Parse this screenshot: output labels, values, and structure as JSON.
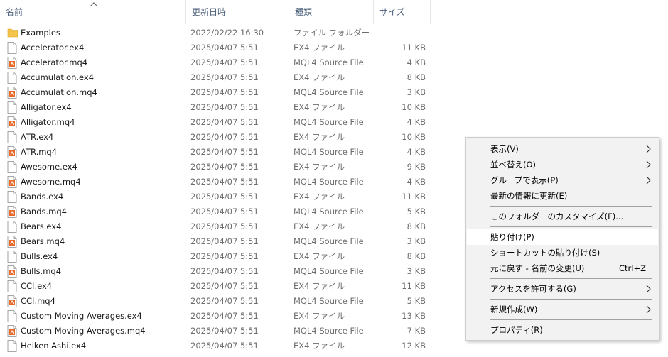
{
  "columns": {
    "name": "名前",
    "date": "更新日時",
    "type": "種類",
    "size": "サイズ"
  },
  "files": [
    {
      "name": "Examples",
      "date": "2022/02/22 16:30",
      "type": "ファイル フォルダー",
      "size": "",
      "icon": "folder-icon"
    },
    {
      "name": "Accelerator.ex4",
      "date": "2025/04/07 5:51",
      "type": "EX4 ファイル",
      "size": "11 KB",
      "icon": "file-icon"
    },
    {
      "name": "Accelerator.mq4",
      "date": "2025/04/07 5:51",
      "type": "MQL4 Source File",
      "size": "4 KB",
      "icon": "mq4-file-icon"
    },
    {
      "name": "Accumulation.ex4",
      "date": "2025/04/07 5:51",
      "type": "EX4 ファイル",
      "size": "8 KB",
      "icon": "file-icon"
    },
    {
      "name": "Accumulation.mq4",
      "date": "2025/04/07 5:51",
      "type": "MQL4 Source File",
      "size": "3 KB",
      "icon": "mq4-file-icon"
    },
    {
      "name": "Alligator.ex4",
      "date": "2025/04/07 5:51",
      "type": "EX4 ファイル",
      "size": "10 KB",
      "icon": "file-icon"
    },
    {
      "name": "Alligator.mq4",
      "date": "2025/04/07 5:51",
      "type": "MQL4 Source File",
      "size": "4 KB",
      "icon": "mq4-file-icon"
    },
    {
      "name": "ATR.ex4",
      "date": "2025/04/07 5:51",
      "type": "EX4 ファイル",
      "size": "10 KB",
      "icon": "file-icon"
    },
    {
      "name": "ATR.mq4",
      "date": "2025/04/07 5:51",
      "type": "MQL4 Source File",
      "size": "4 KB",
      "icon": "mq4-file-icon"
    },
    {
      "name": "Awesome.ex4",
      "date": "2025/04/07 5:51",
      "type": "EX4 ファイル",
      "size": "9 KB",
      "icon": "file-icon"
    },
    {
      "name": "Awesome.mq4",
      "date": "2025/04/07 5:51",
      "type": "MQL4 Source File",
      "size": "4 KB",
      "icon": "mq4-file-icon"
    },
    {
      "name": "Bands.ex4",
      "date": "2025/04/07 5:51",
      "type": "EX4 ファイル",
      "size": "11 KB",
      "icon": "file-icon"
    },
    {
      "name": "Bands.mq4",
      "date": "2025/04/07 5:51",
      "type": "MQL4 Source File",
      "size": "5 KB",
      "icon": "mq4-file-icon"
    },
    {
      "name": "Bears.ex4",
      "date": "2025/04/07 5:51",
      "type": "EX4 ファイル",
      "size": "8 KB",
      "icon": "file-icon"
    },
    {
      "name": "Bears.mq4",
      "date": "2025/04/07 5:51",
      "type": "MQL4 Source File",
      "size": "3 KB",
      "icon": "mq4-file-icon"
    },
    {
      "name": "Bulls.ex4",
      "date": "2025/04/07 5:51",
      "type": "EX4 ファイル",
      "size": "8 KB",
      "icon": "file-icon"
    },
    {
      "name": "Bulls.mq4",
      "date": "2025/04/07 5:51",
      "type": "MQL4 Source File",
      "size": "3 KB",
      "icon": "mq4-file-icon"
    },
    {
      "name": "CCI.ex4",
      "date": "2025/04/07 5:51",
      "type": "EX4 ファイル",
      "size": "11 KB",
      "icon": "file-icon"
    },
    {
      "name": "CCI.mq4",
      "date": "2025/04/07 5:51",
      "type": "MQL4 Source File",
      "size": "5 KB",
      "icon": "mq4-file-icon"
    },
    {
      "name": "Custom Moving Averages.ex4",
      "date": "2025/04/07 5:51",
      "type": "EX4 ファイル",
      "size": "13 KB",
      "icon": "file-icon"
    },
    {
      "name": "Custom Moving Averages.mq4",
      "date": "2025/04/07 5:51",
      "type": "MQL4 Source File",
      "size": "7 KB",
      "icon": "mq4-file-icon"
    },
    {
      "name": "Heiken Ashi.ex4",
      "date": "2025/04/07 5:51",
      "type": "EX4 ファイル",
      "size": "12 KB",
      "icon": "file-icon"
    }
  ],
  "context_menu": {
    "items": [
      {
        "label": "表示(V)",
        "submenu": true,
        "name": "menu-item-view"
      },
      {
        "label": "並べ替え(O)",
        "submenu": true,
        "name": "menu-item-sort"
      },
      {
        "label": "グループで表示(P)",
        "submenu": true,
        "name": "menu-item-group"
      },
      {
        "label": "最新の情報に更新(E)",
        "name": "menu-item-refresh"
      },
      {
        "separator": true
      },
      {
        "label": "このフォルダーのカスタマイズ(F)...",
        "name": "menu-item-customize"
      },
      {
        "separator": true
      },
      {
        "label": "貼り付け(P)",
        "hover": true,
        "name": "menu-item-paste"
      },
      {
        "label": "ショートカットの貼り付け(S)",
        "name": "menu-item-paste-shortcut"
      },
      {
        "label": "元に戻す - 名前の変更(U)",
        "shortcut": "Ctrl+Z",
        "name": "menu-item-undo"
      },
      {
        "separator": true
      },
      {
        "label": "アクセスを許可する(G)",
        "submenu": true,
        "name": "menu-item-give-access"
      },
      {
        "separator": true
      },
      {
        "label": "新規作成(W)",
        "submenu": true,
        "name": "menu-item-new"
      },
      {
        "separator": true
      },
      {
        "label": "プロパティ(R)",
        "name": "menu-item-properties"
      }
    ]
  },
  "colors": {
    "header_text": "#4c607a",
    "folder": "#f4c54a",
    "mq4_accent": "#e8692a",
    "menu_bg": "#f2f2f2",
    "menu_hover": "#ffffff"
  }
}
